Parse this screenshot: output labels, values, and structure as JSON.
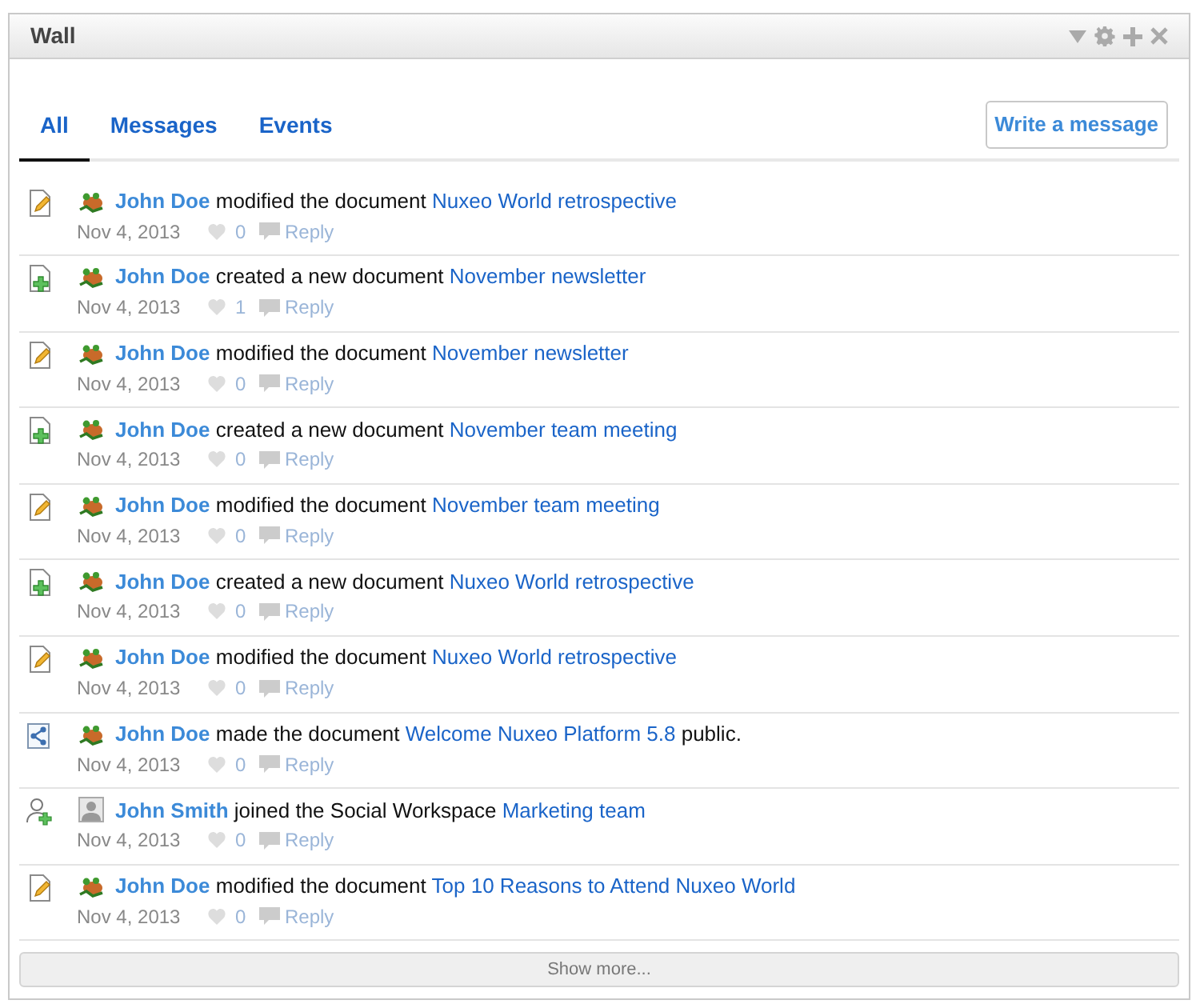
{
  "window": {
    "title": "Wall"
  },
  "tabs": [
    {
      "label": "All",
      "selected": true
    },
    {
      "label": "Messages",
      "selected": false
    },
    {
      "label": "Events",
      "selected": false
    }
  ],
  "write_button": "Write a message",
  "entries": [
    {
      "kind": "modified",
      "avatar": {
        "kind": "frog"
      },
      "actor": "John Doe",
      "action": "modified the document",
      "target": "Nuxeo World retrospective",
      "date": "Nov 4, 2013",
      "likes": "0",
      "reply": "Reply"
    },
    {
      "kind": "created",
      "avatar": {
        "kind": "frog"
      },
      "actor": "John Doe",
      "action": "created a new document",
      "target": "November newsletter",
      "date": "Nov 4, 2013",
      "likes": "1",
      "reply": "Reply"
    },
    {
      "kind": "modified",
      "avatar": {
        "kind": "frog"
      },
      "actor": "John Doe",
      "action": "modified the document",
      "target": "November newsletter",
      "date": "Nov 4, 2013",
      "likes": "0",
      "reply": "Reply"
    },
    {
      "kind": "created",
      "avatar": {
        "kind": "frog"
      },
      "actor": "John Doe",
      "action": "created a new document",
      "target": "November team meeting",
      "date": "Nov 4, 2013",
      "likes": "0",
      "reply": "Reply"
    },
    {
      "kind": "modified",
      "avatar": {
        "kind": "frog"
      },
      "actor": "John Doe",
      "action": "modified the document",
      "target": "November team meeting",
      "date": "Nov 4, 2013",
      "likes": "0",
      "reply": "Reply"
    },
    {
      "kind": "created",
      "avatar": {
        "kind": "frog"
      },
      "actor": "John Doe",
      "action": "created a new document",
      "target": "Nuxeo World retrospective",
      "date": "Nov 4, 2013",
      "likes": "0",
      "reply": "Reply"
    },
    {
      "kind": "modified",
      "avatar": {
        "kind": "frog"
      },
      "actor": "John Doe",
      "action": "modified the document",
      "target": "Nuxeo World retrospective",
      "date": "Nov 4, 2013",
      "likes": "0",
      "reply": "Reply"
    },
    {
      "kind": "shared",
      "avatar": {
        "kind": "frog"
      },
      "actor": "John Doe",
      "action": "made the document",
      "target": "Welcome Nuxeo Platform 5.8",
      "suffix": "public.",
      "date": "Nov 4, 2013",
      "likes": "0",
      "reply": "Reply"
    },
    {
      "kind": "joined",
      "avatar": {
        "kind": "person"
      },
      "actor": "John Smith",
      "action": "joined the Social Workspace",
      "target": "Marketing team",
      "date": "Nov 4, 2013",
      "likes": "0",
      "reply": "Reply"
    },
    {
      "kind": "modified",
      "avatar": {
        "kind": "frog"
      },
      "actor": "John Doe",
      "action": "modified the document",
      "target": "Top 10 Reasons to Attend Nuxeo World",
      "date": "Nov 4, 2013",
      "likes": "0",
      "reply": "Reply"
    }
  ],
  "show_more": "Show more..."
}
